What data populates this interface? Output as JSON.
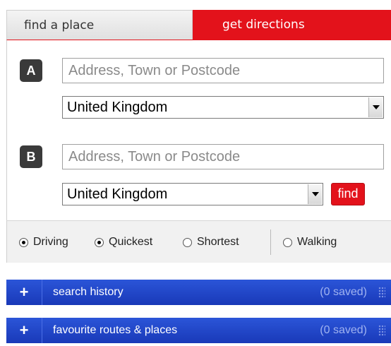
{
  "tabs": {
    "find_place": "find a place",
    "get_directions": "get directions",
    "active": "get_directions"
  },
  "start": {
    "badge": "A",
    "address_placeholder": "Address, Town or Postcode",
    "country": "United Kingdom"
  },
  "end": {
    "badge": "B",
    "address_placeholder": "Address, Town or Postcode",
    "country": "United Kingdom",
    "find_label": "find"
  },
  "modes": {
    "driving": {
      "label": "Driving",
      "selected": true
    },
    "quickest": {
      "label": "Quickest",
      "selected": true
    },
    "shortest": {
      "label": "Shortest",
      "selected": false
    },
    "walking": {
      "label": "Walking",
      "selected": false
    }
  },
  "accordions": [
    {
      "label": "search history",
      "count": "(0 saved)",
      "icon": "plus-icon"
    },
    {
      "label": "favourite routes & places",
      "count": "(0 saved)",
      "icon": "plus-icon"
    }
  ],
  "colors": {
    "accent_red": "#e3121b",
    "accordion_blue": "#1f44c8",
    "badge_dark": "#3a3a3a"
  }
}
